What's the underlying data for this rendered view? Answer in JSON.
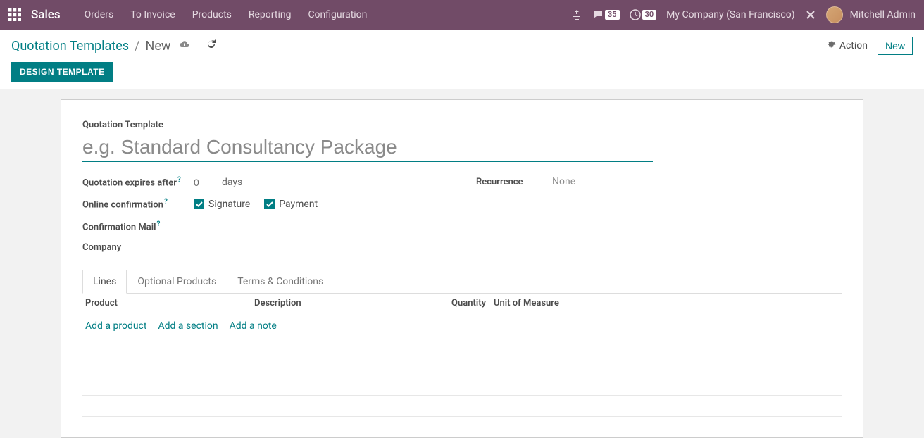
{
  "topbar": {
    "app_name": "Sales",
    "menu": [
      "Orders",
      "To Invoice",
      "Products",
      "Reporting",
      "Configuration"
    ],
    "chat_badge": "35",
    "clock_badge": "30",
    "company": "My Company (San Francisco)",
    "user": "Mitchell Admin"
  },
  "control_panel": {
    "breadcrumb_root": "Quotation Templates",
    "breadcrumb_current": "New",
    "action_label": "Action",
    "new_label": "New",
    "design_label": "DESIGN TEMPLATE"
  },
  "form": {
    "title_label": "Quotation Template",
    "title_placeholder": "e.g. Standard Consultancy Package",
    "expires_label": "Quotation expires after",
    "expires_value": "0",
    "expires_unit": "days",
    "online_label": "Online confirmation",
    "signature_label": "Signature",
    "payment_label": "Payment",
    "mail_label": "Confirmation Mail",
    "company_label": "Company",
    "recurrence_label": "Recurrence",
    "recurrence_value": "None"
  },
  "tabs": {
    "lines": "Lines",
    "optional": "Optional Products",
    "terms": "Terms & Conditions"
  },
  "table": {
    "col_product": "Product",
    "col_desc": "Description",
    "col_qty": "Quantity",
    "col_uom": "Unit of Measure",
    "add_product": "Add a product",
    "add_section": "Add a section",
    "add_note": "Add a note"
  }
}
